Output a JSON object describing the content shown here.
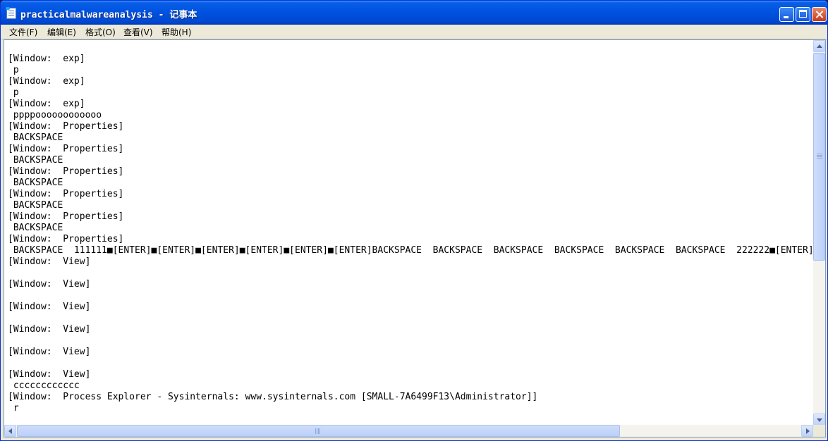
{
  "window": {
    "title": "practicalmalwareanalysis - 记事本"
  },
  "menu": {
    "items": [
      "文件(F)",
      "编辑(E)",
      "格式(O)",
      "查看(V)",
      "帮助(H)"
    ]
  },
  "editor": {
    "lines": [
      "",
      "[Window:  exp]",
      " p",
      "[Window:  exp]",
      " p",
      "[Window:  exp]",
      " ppppoooooooooooo",
      "[Window:  Properties]",
      " BACKSPACE",
      "[Window:  Properties]",
      " BACKSPACE",
      "[Window:  Properties]",
      " BACKSPACE",
      "[Window:  Properties]",
      " BACKSPACE",
      "[Window:  Properties]",
      " BACKSPACE",
      "[Window:  Properties]",
      " BACKSPACE  111111■[ENTER]■[ENTER]■[ENTER]■[ENTER]■[ENTER]■[ENTER]BACKSPACE  BACKSPACE  BACKSPACE  BACKSPACE  BACKSPACE  BACKSPACE  222222■[ENTER]",
      "[Window:  View]",
      "",
      "[Window:  View]",
      "",
      "[Window:  View]",
      "",
      "[Window:  View]",
      "",
      "[Window:  View]",
      "",
      "[Window:  View]",
      " cccccccccccc",
      "[Window:  Process Explorer - Sysinternals: www.sysinternals.com [SMALL-7A6499F13\\Administrator]]",
      " r"
    ]
  },
  "icons": {
    "app": "notepad-icon",
    "minimize": "minimize-icon",
    "maximize": "maximize-icon",
    "close": "close-icon"
  }
}
